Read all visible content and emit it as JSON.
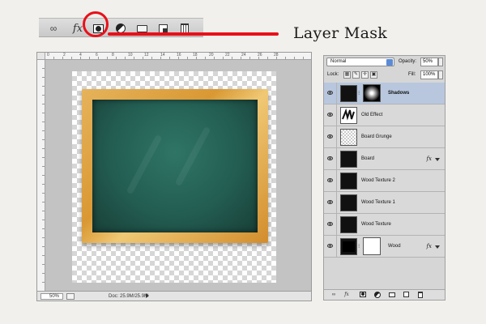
{
  "annotation": {
    "label": "Layer Mask",
    "highlight_color": "#e8101a"
  },
  "top_toolbar": {
    "buttons": [
      {
        "name": "link-layers",
        "icon": "chain-link-icon",
        "glyph": "∞"
      },
      {
        "name": "layer-style",
        "icon": "fx-icon",
        "glyph": "fx"
      },
      {
        "name": "add-layer-mask",
        "icon": "layer-mask-icon",
        "glyph": "◘"
      },
      {
        "name": "adjustment-layer",
        "icon": "half-circle-icon",
        "glyph": "◐"
      },
      {
        "name": "new-group",
        "icon": "folder-icon",
        "glyph": "▭"
      },
      {
        "name": "new-layer",
        "icon": "new-layer-icon",
        "glyph": "◪"
      },
      {
        "name": "delete-layer",
        "icon": "trash-icon",
        "glyph": "🗑"
      }
    ]
  },
  "canvas": {
    "zoom": "50%",
    "doc_info": "Doc: 25.9M/25.9M",
    "ruler_numbers": [
      "0",
      "2",
      "4",
      "6",
      "8",
      "10",
      "12",
      "14",
      "16",
      "18",
      "20",
      "22",
      "24",
      "26",
      "28"
    ]
  },
  "layers_panel": {
    "blend_mode": "Normal",
    "opacity_label": "Opacity:",
    "opacity_value": "50%",
    "lock_label": "Lock:",
    "fill_label": "Fill:",
    "fill_value": "100%",
    "layers": [
      {
        "name": "Shadows",
        "selected": true,
        "thumb": "dark",
        "mask": "dark",
        "fx": false
      },
      {
        "name": "Old Effect",
        "selected": false,
        "thumb": "scribble",
        "mask": null,
        "fx": false
      },
      {
        "name": "Board Grunge",
        "selected": false,
        "thumb": "checker",
        "mask": null,
        "fx": false
      },
      {
        "name": "Board",
        "selected": false,
        "thumb": "dark",
        "mask": null,
        "fx": true
      },
      {
        "name": "Wood Texture 2",
        "selected": false,
        "thumb": "dark",
        "mask": null,
        "fx": false
      },
      {
        "name": "Wood Texture 1",
        "selected": false,
        "thumb": "dark",
        "mask": null,
        "fx": false
      },
      {
        "name": "Wood Texture",
        "selected": false,
        "thumb": "dark",
        "mask": null,
        "fx": false
      },
      {
        "name": "Wood",
        "selected": false,
        "thumb": "framed",
        "mask": "white",
        "fx": true
      }
    ],
    "fx_label": "fx"
  }
}
